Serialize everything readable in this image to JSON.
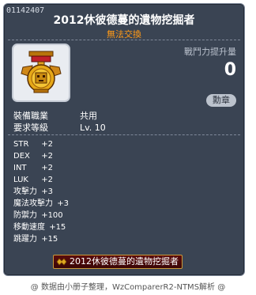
{
  "tooltip": {
    "item_id": "01142407",
    "title": "2012休彼德蔓的遺物挖掘者",
    "trade_status": "無法交換",
    "power": {
      "label": "戰鬥力提升量",
      "value": "0"
    },
    "medal_button": "勳章",
    "requirements": [
      {
        "label": "裝備職業",
        "value": "共用"
      },
      {
        "label": "要求等級",
        "value": "Lv. 10"
      }
    ],
    "stats": [
      {
        "name": "STR",
        "value": "+2"
      },
      {
        "name": "DEX",
        "value": "+2"
      },
      {
        "name": "INT",
        "value": "+2"
      },
      {
        "name": "LUK",
        "value": "+2"
      },
      {
        "name": "攻擊力",
        "value": "+3"
      },
      {
        "name": "魔法攻擊力",
        "value": "+3"
      },
      {
        "name": "防禦力",
        "value": "+100"
      },
      {
        "name": "移動速度",
        "value": "+15"
      },
      {
        "name": "跳躍力",
        "value": "+15"
      }
    ],
    "title_badge": "2012休彼德蔓的遺物挖掘者",
    "icon": "golden-medal-icon"
  },
  "footer": "@ 数据由小册子整理，WzComparerR2-NTMS解析 @",
  "colors": {
    "panel_bg": "#3a4453",
    "trade_status": "#ff9a17",
    "badge_bg": "#5b0c0c",
    "badge_border": "#c99a3a"
  }
}
